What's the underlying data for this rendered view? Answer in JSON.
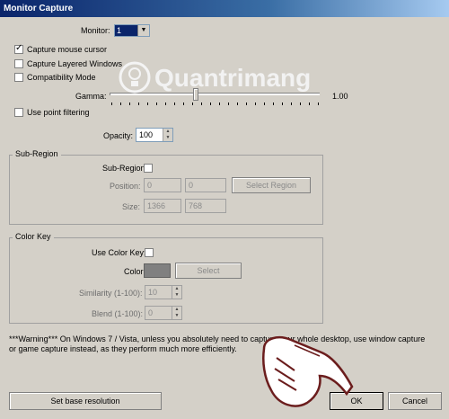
{
  "window": {
    "title": "Monitor Capture"
  },
  "monitor": {
    "label": "Monitor:",
    "value": "1"
  },
  "options": {
    "capture_mouse": {
      "label": "Capture mouse cursor",
      "checked": true
    },
    "capture_layered": {
      "label": "Capture Layered Windows",
      "checked": false
    },
    "compatibility": {
      "label": "Compatibility Mode",
      "checked": false
    },
    "point_filtering": {
      "label": "Use point filtering",
      "checked": false
    }
  },
  "gamma": {
    "label": "Gamma:",
    "value": "1.00"
  },
  "opacity": {
    "label": "Opacity:",
    "value": "100"
  },
  "subregion": {
    "group_title": "Sub-Region",
    "checkbox_label": "Sub-Region",
    "position_label": "Position:",
    "pos_x": "0",
    "pos_y": "0",
    "select_region_label": "Select Region",
    "size_label": "Size:",
    "width": "1366",
    "height": "768"
  },
  "colorkey": {
    "group_title": "Color Key",
    "use_label": "Use Color Key:",
    "color_label": "Color",
    "select_label": "Select",
    "similarity_label": "Similarity (1-100):",
    "similarity_value": "10",
    "blend_label": "Blend (1-100):",
    "blend_value": "0",
    "swatch_color": "#808080"
  },
  "warning": "***Warning*** On Windows 7 / Vista, unless you absolutely need to capture your whole desktop, use window capture or game capture instead, as they perform much more efficiently.",
  "footer": {
    "base_resolution_label": "Set base resolution",
    "ok_label": "OK",
    "cancel_label": "Cancel"
  },
  "watermark": {
    "text": "Quantrimang"
  },
  "colors": {
    "titlebar": "#0a246a",
    "dialog_bg": "#d4d0c8",
    "watermark": "#f0f0f0"
  }
}
